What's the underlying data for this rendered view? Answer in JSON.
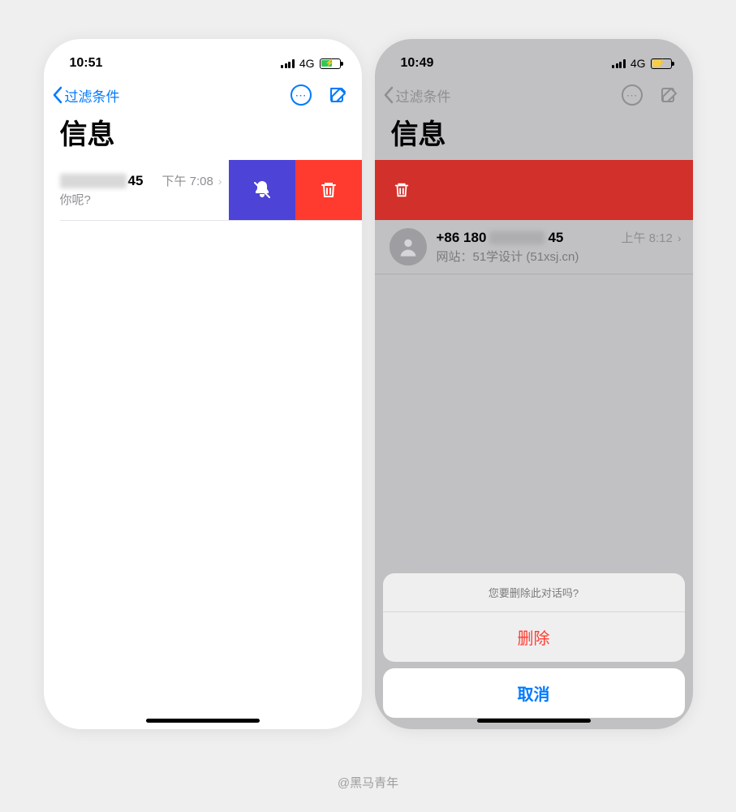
{
  "credit": "@黑马青年",
  "left": {
    "status": {
      "time": "10:51",
      "network": "4G"
    },
    "nav": {
      "back": "过滤条件"
    },
    "title": "信息",
    "message": {
      "name_suffix": "45",
      "time": "下午 7:08",
      "preview": "你呢?"
    }
  },
  "right": {
    "status": {
      "time": "10:49",
      "network": "4G"
    },
    "nav": {
      "back": "过滤条件"
    },
    "title": "信息",
    "message": {
      "name_prefix": "+86 180",
      "name_suffix": "45",
      "time": "上午 8:12",
      "preview": "网站：51学设计 (51xsj.cn)"
    },
    "sheet": {
      "title": "您要删除此对话吗?",
      "delete": "删除",
      "cancel": "取消"
    }
  }
}
